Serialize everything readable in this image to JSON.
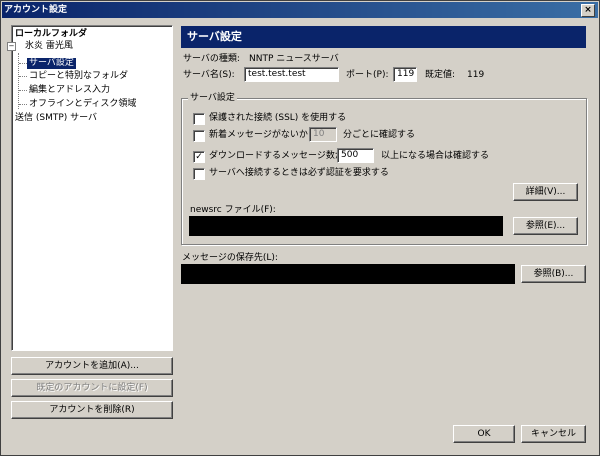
{
  "window": {
    "title": "アカウント設定"
  },
  "tree": {
    "items": [
      {
        "label": "ローカルフォルダ"
      },
      {
        "label": "氷炎 雷光風"
      },
      {
        "label": "サーバ設定"
      },
      {
        "label": "コピーと特別なフォルダ"
      },
      {
        "label": "編集とアドレス入力"
      },
      {
        "label": "オフラインとディスク領域"
      },
      {
        "label": "送信 (SMTP) サーバ"
      }
    ],
    "expander_symbol": "−"
  },
  "left_buttons": {
    "add": "アカウントを追加(A)...",
    "set_default": "既定のアカウントに設定(F)",
    "delete": "アカウントを削除(R)"
  },
  "panel": {
    "header": "サーバ設定",
    "server_type_label": "サーバの種類:",
    "server_type_value": "NNTP ニュースサーバ",
    "server_name_label": "サーバ名(S):",
    "server_name_value": "test.test.test",
    "port_label": "ポート(P):",
    "port_value": "119",
    "default_label": "既定値:",
    "default_value": "119",
    "group_title": "サーバ設定",
    "options": {
      "ssl": {
        "label": "保護された接続 (SSL) を使用する",
        "checked": false
      },
      "new_messages": {
        "label_pre": "新着メッセージがないか",
        "value": "10",
        "label_post": "分ごとに確認する",
        "checked": false
      },
      "download": {
        "label_pre": "ダウンロードするメッセージ数が",
        "value": "500",
        "label_post": "以上になる場合は確認する",
        "checked": true
      },
      "auth": {
        "label": "サーバへ接続するときは必ず認証を要求する",
        "checked": false
      }
    },
    "detail_button": "詳細(V)...",
    "newsrc_label": "newsrc ファイル(F):",
    "browse_button_1": "参照(E)...",
    "storage_label": "メッセージの保存先(L):",
    "browse_button_2": "参照(B)..."
  },
  "footer": {
    "ok": "OK",
    "cancel": "キャンセル"
  },
  "check_mark": "✓",
  "colors": {
    "titlebar": "#0a246a",
    "selection": "#0a246a",
    "face": "#d4d0c8"
  }
}
